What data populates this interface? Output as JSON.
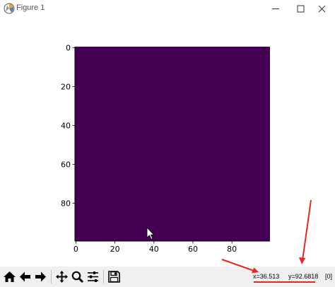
{
  "window": {
    "title": "Figure 1",
    "app_icon": "matplotlib-icon",
    "controls": [
      "minimize-icon",
      "maximize-icon",
      "close-icon"
    ]
  },
  "figure": {
    "image_color": "#440154",
    "colormap": "viridis",
    "x_ticks": [
      "0",
      "20",
      "40",
      "60",
      "80"
    ],
    "y_ticks": [
      "0",
      "20",
      "40",
      "60",
      "80"
    ]
  },
  "toolbar": {
    "buttons": [
      "home-icon",
      "back-icon",
      "forward-icon",
      "pan-icon",
      "zoom-icon",
      "configure-subplots-icon",
      "save-icon"
    ],
    "coord_x": "x=36.513",
    "coord_y": "y=92.6818",
    "pixel_value": "[0]"
  },
  "annotation_color": "#e8261c"
}
